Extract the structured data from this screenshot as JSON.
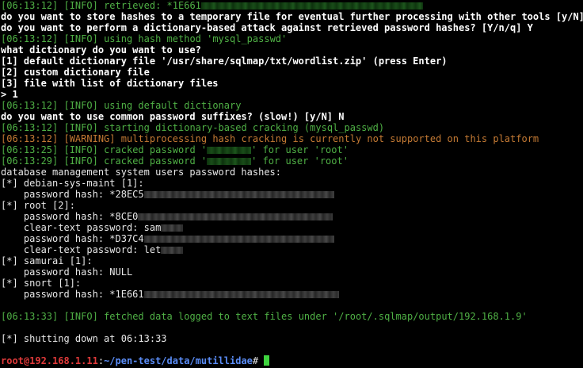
{
  "retrieved_line": {
    "ts": "[06:13:12]",
    "level": "[INFO]",
    "text": " retrieved: ",
    "hash_prefix": "*1E661"
  },
  "q_store": {
    "text": "do you want to store hashes to a temporary file for eventual further processing with other tools [y/N] N"
  },
  "q_attack": {
    "text": "do you want to perform a dictionary-based attack against retrieved password hashes? [Y/n/q] Y"
  },
  "info_method": {
    "ts": "[06:13:12]",
    "level": "[INFO]",
    "text": " using hash method 'mysql_passwd'"
  },
  "q_dict": {
    "text": "what dictionary do you want to use?"
  },
  "opt1": {
    "text": "[1] default dictionary file '/usr/share/sqlmap/txt/wordlist.zip' (press Enter)"
  },
  "opt2": {
    "text": "[2] custom dictionary file"
  },
  "opt3": {
    "text": "[3] file with list of dictionary files"
  },
  "answer": {
    "text": "> 1"
  },
  "info_default": {
    "ts": "[06:13:12]",
    "level": "[INFO]",
    "text": " using default dictionary"
  },
  "q_suffix": {
    "text": "do you want to use common password suffixes? (slow!) [y/N] N"
  },
  "info_start": {
    "ts": "[06:13:12]",
    "level": "[INFO]",
    "text": " starting dictionary-based cracking (mysql_passwd)"
  },
  "warning": {
    "ts": "[06:13:12]",
    "level": "[WARNING]",
    "text": " multiprocessing hash cracking is currently not supported on this platform"
  },
  "cracked1": {
    "ts": "[06:13:25]",
    "level": "[INFO]",
    "pre": " cracked password '",
    "post": "' for user 'root'"
  },
  "cracked2": {
    "ts": "[06:13:29]",
    "level": "[INFO]",
    "pre": " cracked password '",
    "post": "' for user 'root'"
  },
  "heading": {
    "text": "database management system users password hashes:"
  },
  "u1_header": {
    "text": "[*] debian-sys-maint [1]:"
  },
  "u1_hash": {
    "text": "    password hash: *28EC5"
  },
  "u2_header": {
    "text": "[*] root [2]:"
  },
  "u2_hash1": {
    "text": "    password hash: *8CE0"
  },
  "u2_clear1": {
    "text": "    clear-text password: sam"
  },
  "u2_hash2": {
    "text": "    password hash: *D37C4"
  },
  "u2_clear2": {
    "text": "    clear-text password: let"
  },
  "u3_header": {
    "text": "[*] samurai [1]:"
  },
  "u3_hash": {
    "text": "    password hash: NULL"
  },
  "u4_header": {
    "text": "[*] snort [1]:"
  },
  "u4_hash": {
    "text": "    password hash: *1E661"
  },
  "fetched": {
    "ts": "[06:13:33]",
    "level": "[INFO]",
    "text": " fetched data logged to text files under '/root/.sqlmap/output/192.168.1.9'"
  },
  "shutdown": {
    "text": "[*] shutting down at 06:13:33"
  },
  "prompt": {
    "userhost": "root@192.168.1.11",
    "sep": ":",
    "path": "~/pen-test/data/mutillidae",
    "symbol": "# "
  },
  "colors": {
    "info_green": "#4fb045",
    "warning_orange": "#c47a34",
    "prompt_red": "#e03a3a",
    "prompt_blue": "#5a8cf5",
    "cursor": "#3fd43f"
  }
}
